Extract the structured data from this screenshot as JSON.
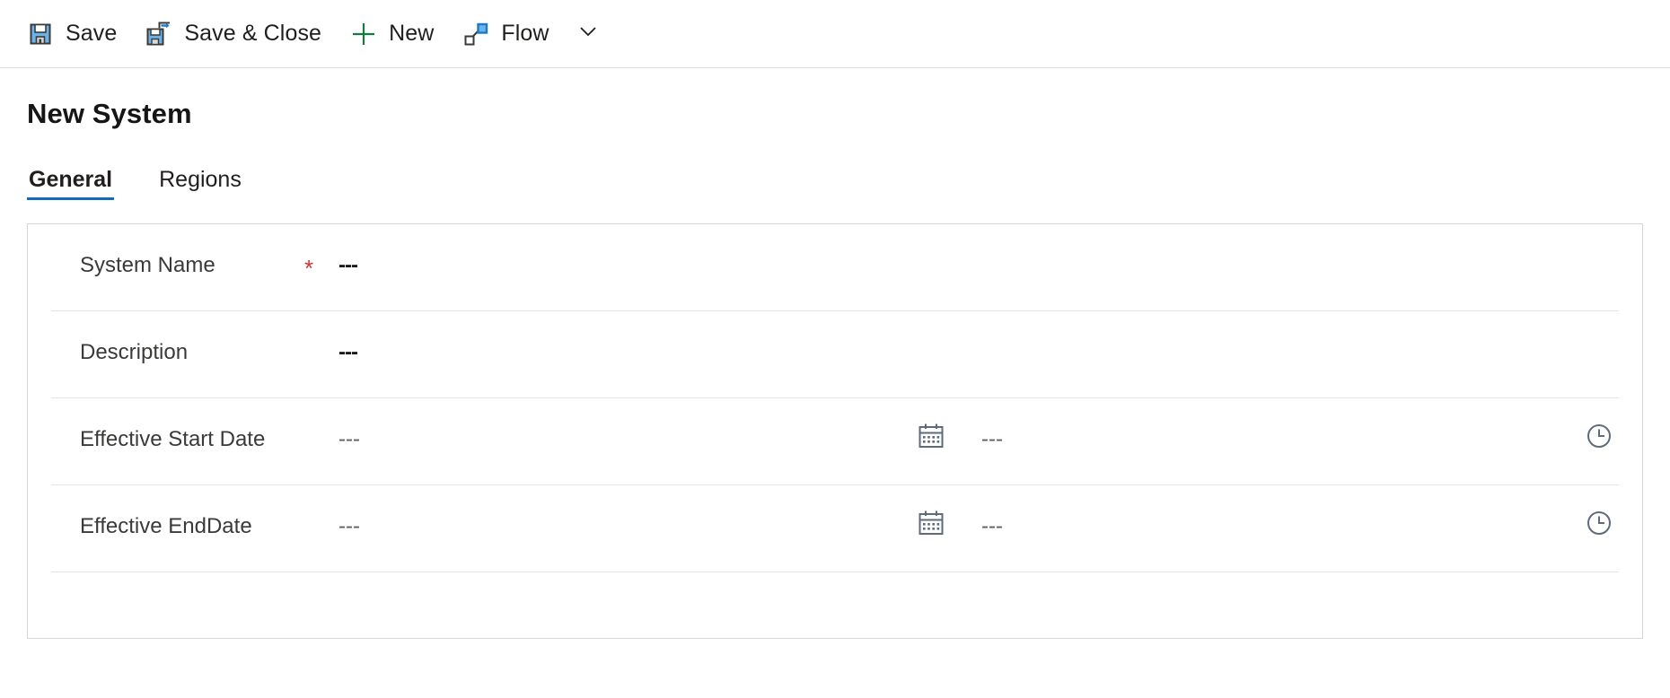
{
  "toolbar": {
    "buttons": [
      {
        "label": "Save",
        "icon": "save-icon"
      },
      {
        "label": "Save & Close",
        "icon": "save-and-close-icon"
      },
      {
        "label": "New",
        "icon": "plus-icon"
      },
      {
        "label": "Flow",
        "icon": "flow-icon"
      }
    ],
    "overflow_icon": "chevron-down-icon"
  },
  "page": {
    "title": "New System"
  },
  "tabs": [
    {
      "label": "General",
      "active": true
    },
    {
      "label": "Regions",
      "active": false
    }
  ],
  "form": {
    "fields": [
      {
        "label": "System Name",
        "required": true,
        "required_marker": "*",
        "value": "---"
      },
      {
        "label": "Description",
        "required": false,
        "value": "---"
      },
      {
        "label": "Effective Start Date",
        "required": false,
        "value": "---",
        "date_icon": "calendar-icon",
        "time_value": "---",
        "time_icon": "clock-icon"
      },
      {
        "label": "Effective EndDate",
        "required": false,
        "value": "---",
        "date_icon": "calendar-icon",
        "time_value": "---",
        "time_icon": "clock-icon"
      }
    ]
  },
  "colors": {
    "accent": "#0f6cbd",
    "required": "#d03535",
    "new_plus": "#107c41",
    "icon_blue": "#1f7ac4",
    "icon_dark": "#3b3a39",
    "border": "#d6d6d6",
    "divider": "#e3e3e3"
  }
}
